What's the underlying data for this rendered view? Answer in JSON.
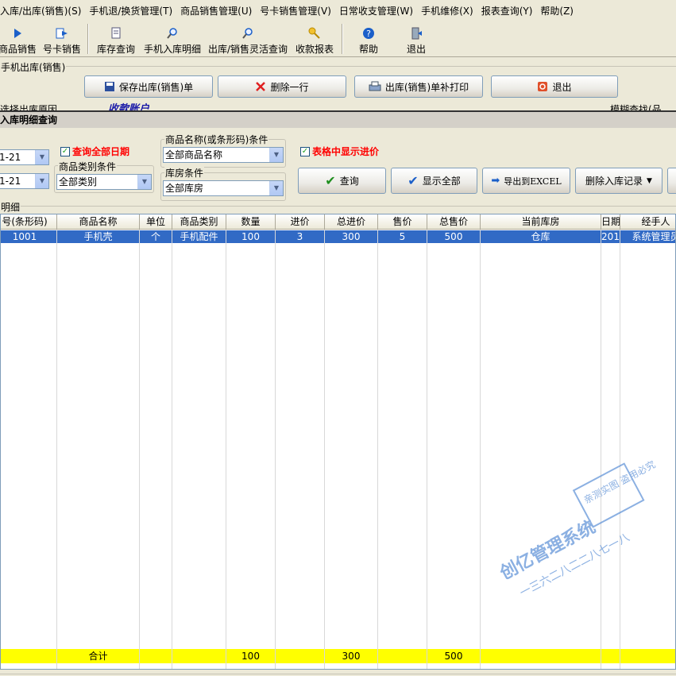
{
  "menu": [
    "入库/出库(销售)(S)",
    "手机退/换货管理(T)",
    "商品销售管理(U)",
    "号卡销售管理(V)",
    "日常收支管理(W)",
    "手机维修(X)",
    "报表查询(Y)",
    "帮助(Z)"
  ],
  "toolbar": {
    "items": [
      "商品销售",
      "号卡销售",
      "库存查询",
      "手机入库明细",
      "出库/销售灵活查询",
      "收款报表",
      "帮助",
      "退出"
    ]
  },
  "back_window": {
    "group_title": "手机出库(销售)",
    "save_label": "保存出库(销售)单",
    "delete_row_label": "删除一行",
    "reprint_label": "出库(销售)单补打印",
    "exit_label": "退出",
    "partial_left": "选择出库原因",
    "partial_mid": "收款账户",
    "partial_right": "模糊查找(品"
  },
  "query": {
    "title": "入库明细查询",
    "date_from": "1-21",
    "date_to": "1-21",
    "all_dates_label": "查询全部日期",
    "category_group": "商品类别条件",
    "category_value": "全部类别",
    "name_group": "商品名称(或条形码)条件",
    "name_value": "全部商品名称",
    "warehouse_group": "库房条件",
    "warehouse_value": "全部库房",
    "show_price_label": "表格中显示进价",
    "query_btn": "查询",
    "show_all_btn": "显示全部",
    "export_btn": "导出到EXCEL",
    "delete_btn": "删除入库记录",
    "detail_group": "明细"
  },
  "table": {
    "headers": [
      "号(条形码)",
      "商品名称",
      "单位",
      "商品类别",
      "数量",
      "进价",
      "总进价",
      "售价",
      "总售价",
      "当前库房",
      "日期",
      "经手人"
    ],
    "rows": [
      [
        "1001",
        "手机壳",
        "个",
        "手机配件",
        "100",
        "3",
        "300",
        "5",
        "500",
        "仓库",
        "201",
        "系统管理员"
      ]
    ],
    "totals": {
      "label": "合计",
      "qty": "100",
      "cost_total": "300",
      "sale_total": "500"
    }
  },
  "watermark": {
    "line1": "创亿管理系统",
    "line2": "一三六二八二二八七一八",
    "stamp": "亲测实图 盗用必究"
  },
  "colors": {
    "selected_row": "#316AC5",
    "totals_bg": "#FFFF00",
    "checkbox_label": "#FF0000",
    "watermark": "#5B8FD6"
  }
}
